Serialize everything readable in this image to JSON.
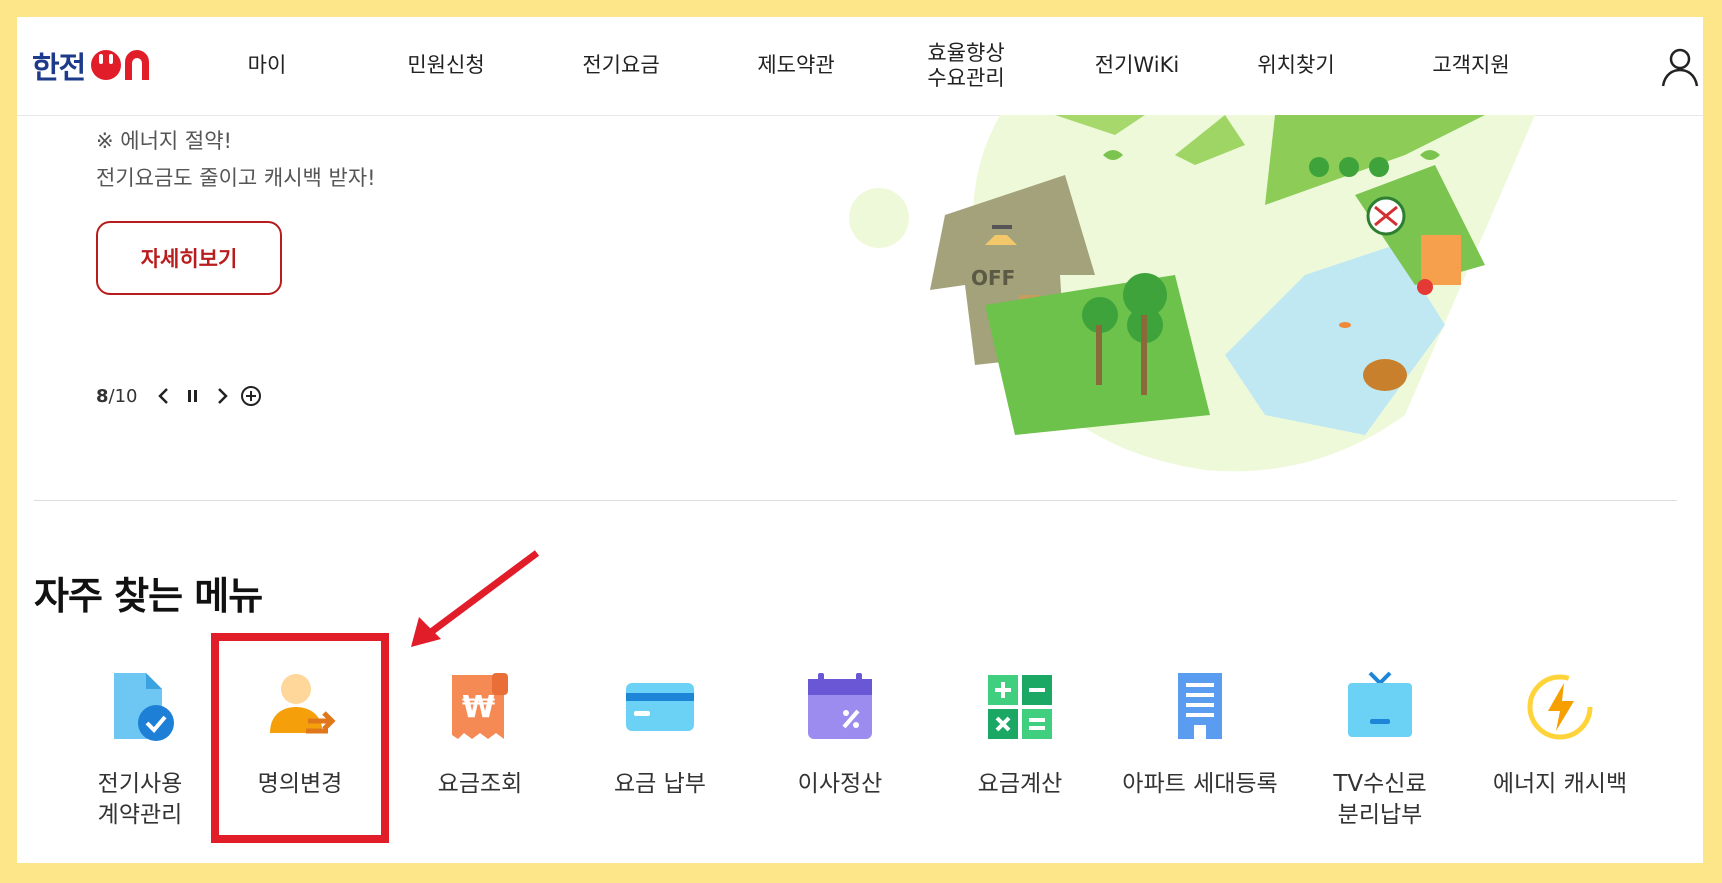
{
  "header": {
    "logo": {
      "text": "한전",
      "suffix": "ON"
    },
    "nav": [
      {
        "label": "마이"
      },
      {
        "label": "민원신청"
      },
      {
        "label": "전기요금"
      },
      {
        "label": "제도약관"
      },
      {
        "label": "효율향상\n수요관리"
      },
      {
        "label": "전기WiKi"
      },
      {
        "label": "위치찾기"
      },
      {
        "label": "고객지원"
      }
    ],
    "user_icon": "user-icon"
  },
  "hero": {
    "line1": "※ 에너지 절약!",
    "line2": "전기요금도 줄이고 캐시백 받자!",
    "button_label": "자세히보기",
    "pager": {
      "current": "8",
      "separator": " / ",
      "total": "10"
    },
    "illustration_text": "OFF"
  },
  "menu": {
    "title": "자주 찾는 메뉴",
    "items": [
      {
        "label": "전기사용\n계약관리",
        "icon": "contract-document-icon"
      },
      {
        "label": "명의변경",
        "icon": "person-transfer-icon"
      },
      {
        "label": "요금조회",
        "icon": "won-receipt-icon"
      },
      {
        "label": "요금 납부",
        "icon": "credit-card-icon"
      },
      {
        "label": "이사정산",
        "icon": "calendar-percent-icon"
      },
      {
        "label": "요금계산",
        "icon": "calculator-icon"
      },
      {
        "label": "아파트 세대등록",
        "icon": "apartment-building-icon"
      },
      {
        "label": "TV수신료\n분리납부",
        "icon": "tv-icon"
      },
      {
        "label": "에너지 캐시백",
        "icon": "energy-bolt-icon"
      }
    ]
  },
  "colors": {
    "frame": "#fde68a",
    "brand_blue": "#1e3a8a",
    "brand_red": "#e11d2a",
    "button_red": "#b91c1c",
    "highlight": "#e11d2a"
  }
}
